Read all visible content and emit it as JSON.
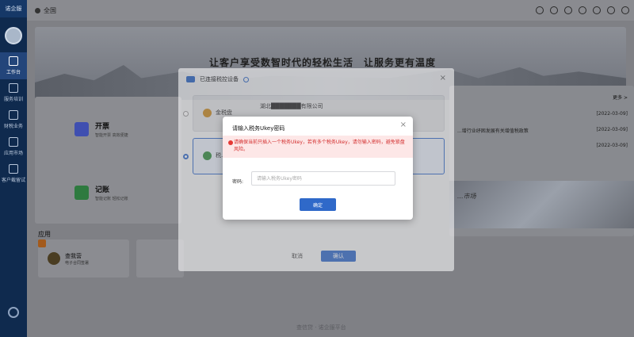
{
  "app": {
    "brand": "诺企服"
  },
  "colors": {
    "primary": "#2f69c9",
    "warning": "#d32f2f",
    "rail": "#0f2a4e"
  },
  "sidebar": {
    "items": [
      {
        "label": "工作台",
        "icon": "home-icon",
        "active": true
      },
      {
        "label": "服务培训",
        "icon": "book-icon"
      },
      {
        "label": "财税业务",
        "icon": "shield-icon"
      },
      {
        "label": "应用市场",
        "icon": "store-icon"
      },
      {
        "label": "客户截留试",
        "icon": "square-icon"
      }
    ]
  },
  "header": {
    "home_tab": "全国"
  },
  "banner": {
    "slogan": "让客户享受数智时代的轻松生活　让服务更有温度"
  },
  "features": [
    {
      "title": "开票",
      "desc": "智能开票 高效便捷",
      "color": "#3f4fb0"
    },
    {
      "title": "记账",
      "desc": "智能记账 轻松记账",
      "color": "#2e7a3f"
    }
  ],
  "news": {
    "more_label": "更多 >",
    "items": [
      {
        "title": "",
        "date": "[2022-03-09]"
      },
      {
        "title": "...增行业纾困发展有关增值税政策",
        "date": "[2022-03-09]"
      },
      {
        "title": "",
        "date": "[2022-03-09]"
      }
    ],
    "image_text": "...市场"
  },
  "apps": {
    "section_title": "应用",
    "items": [
      {
        "name": "查我营",
        "desc": "电子合同签署"
      }
    ]
  },
  "footer": {
    "brand": "查信贷 · 诺企服平台"
  },
  "device_dialog": {
    "title": "已连接税控设备",
    "devices": [
      {
        "name": "金税盘",
        "company": "湖北███████有限公司",
        "selected": false,
        "icon_color": "#c8871c"
      },
      {
        "name": "税...",
        "company": "",
        "selected": true,
        "icon_color": "#2e8b3a"
      }
    ],
    "cancel_label": "取消",
    "ok_label": "确认"
  },
  "password_dialog": {
    "title": "请输入税务Ukey密码",
    "warning": "请确保当前只插入一个税务Ukey，若有多个税务Ukey，请勿输入密码，避免锁盘风险。",
    "field_label": "密码:",
    "placeholder": "请输入税务Ukey密码",
    "value": "",
    "confirm_label": "确定"
  }
}
